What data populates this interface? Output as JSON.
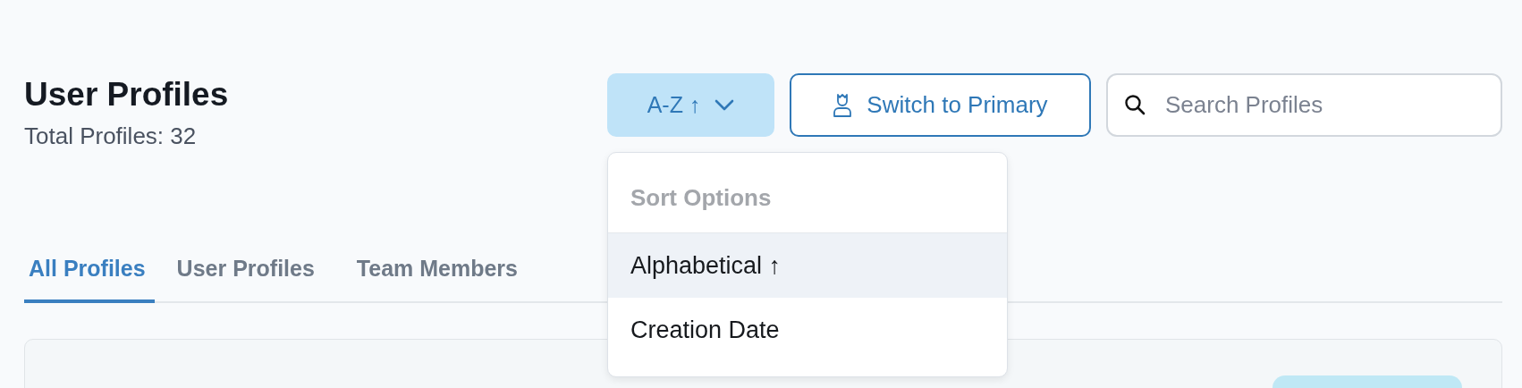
{
  "header": {
    "title": "User Profiles",
    "subtitle": "Total Profiles: 32"
  },
  "sort_button": {
    "label": "A-Z ↑",
    "expanded": true
  },
  "switch_button": {
    "label": "Switch to Primary"
  },
  "search": {
    "placeholder": "Search Profiles"
  },
  "sort_menu": {
    "heading": "Sort Options",
    "items": [
      {
        "label": "Alphabetical ↑",
        "selected": true
      },
      {
        "label": "Creation Date",
        "selected": false
      }
    ]
  },
  "tabs": [
    {
      "label": "All Profiles",
      "selected": true
    },
    {
      "label": "User Profiles",
      "selected": false
    },
    {
      "label": "Team Members",
      "selected": false
    }
  ]
}
